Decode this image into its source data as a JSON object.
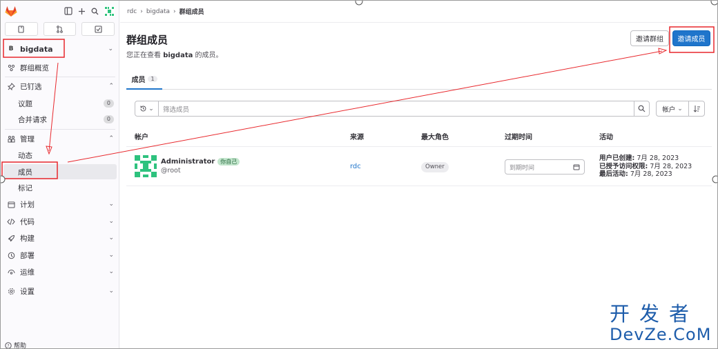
{
  "sidebar": {
    "context_badge": "B",
    "context_name": "bigdata",
    "items": [
      {
        "label": "群组概览",
        "icon": "group-icon"
      },
      {
        "label": "已钉选",
        "icon": "pin-icon"
      },
      {
        "label": "议题",
        "count": "0"
      },
      {
        "label": "合并请求",
        "count": "0"
      },
      {
        "label": "管理",
        "icon": "manage-icon"
      },
      {
        "label": "动态"
      },
      {
        "label": "成员"
      },
      {
        "label": "标记"
      },
      {
        "label": "计划",
        "icon": "calendar-icon"
      },
      {
        "label": "代码",
        "icon": "code-icon"
      },
      {
        "label": "构建",
        "icon": "rocket-icon"
      },
      {
        "label": "部署",
        "icon": "deploy-icon"
      },
      {
        "label": "运维",
        "icon": "monitor-icon"
      },
      {
        "label": "设置",
        "icon": "settings-icon"
      }
    ],
    "help": "帮助"
  },
  "breadcrumb": [
    "rdc",
    "bigdata",
    "群组成员"
  ],
  "page": {
    "title": "群组成员",
    "desc_prefix": "您正在查看 ",
    "desc_group": "bigdata",
    "desc_suffix": " 的成员。",
    "invite_group": "邀请群组",
    "invite_members": "邀请成员"
  },
  "tabs": [
    {
      "label": "成员",
      "count": "1"
    }
  ],
  "filter": {
    "placeholder": "筛选成员",
    "sort_label": "帐户"
  },
  "table": {
    "headers": [
      "帐户",
      "来源",
      "最大角色",
      "过期时间",
      "活动"
    ],
    "rows": [
      {
        "name": "Administrator",
        "self_badge": "你自己",
        "handle": "@root",
        "source": "rdc",
        "role": "Owner",
        "expire_placeholder": "到期时间",
        "act1_label": "用户已创建:",
        "act1_val": " 7月 28, 2023",
        "act2_label": "已授予访问权限:",
        "act2_val": " 7月 28, 2023",
        "act3_label": "最后活动:",
        "act3_val": " 7月 28, 2023"
      }
    ]
  },
  "watermark": {
    "line1": "开发者",
    "line2": "DevZe.CoM"
  },
  "colors": {
    "primary": "#1f75cb",
    "annotation": "#e8262b",
    "watermark": "#1e5dab"
  }
}
